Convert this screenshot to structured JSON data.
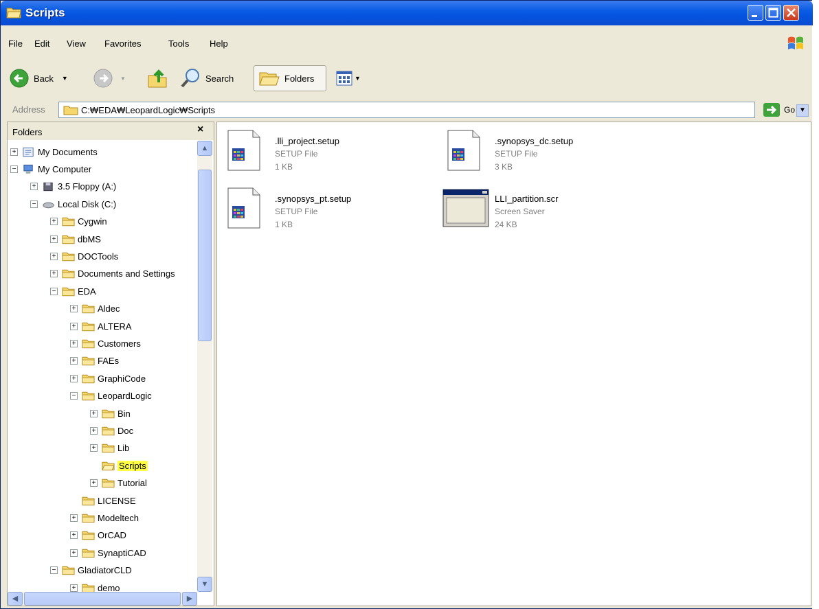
{
  "window": {
    "title": "Scripts"
  },
  "menubar": {
    "items": [
      "File",
      "Edit",
      "View",
      "Favorites",
      "Tools",
      "Help"
    ]
  },
  "toolbar": {
    "back": "Back",
    "search": "Search",
    "folders": "Folders"
  },
  "address": {
    "label": "Address",
    "path": "C:₩EDA₩LeopardLogic₩Scripts",
    "go": "Go"
  },
  "folders_pane": {
    "title": "Folders",
    "close": "×",
    "tree": [
      {
        "label": "My Documents",
        "level": 0,
        "expander": "+",
        "icon": "my-documents-icon"
      },
      {
        "label": "My Computer",
        "level": 0,
        "expander": "−",
        "icon": "my-computer-icon"
      },
      {
        "label": "3.5 Floppy (A:)",
        "level": 1,
        "expander": "+",
        "icon": "floppy-icon"
      },
      {
        "label": "Local Disk (C:)",
        "level": 1,
        "expander": "−",
        "icon": "disk-icon"
      },
      {
        "label": "Cygwin",
        "level": 2,
        "expander": "+",
        "icon": "folder-icon"
      },
      {
        "label": "dbMS",
        "level": 2,
        "expander": "+",
        "icon": "folder-icon"
      },
      {
        "label": "DOCTools",
        "level": 2,
        "expander": "+",
        "icon": "folder-icon"
      },
      {
        "label": "Documents and Settings",
        "level": 2,
        "expander": "+",
        "icon": "folder-icon"
      },
      {
        "label": "EDA",
        "level": 2,
        "expander": "−",
        "icon": "folder-icon"
      },
      {
        "label": "Aldec",
        "level": 3,
        "expander": "+",
        "icon": "folder-icon"
      },
      {
        "label": "ALTERA",
        "level": 3,
        "expander": "+",
        "icon": "folder-icon"
      },
      {
        "label": "Customers",
        "level": 3,
        "expander": "+",
        "icon": "folder-icon"
      },
      {
        "label": "FAEs",
        "level": 3,
        "expander": "+",
        "icon": "folder-icon"
      },
      {
        "label": "GraphiCode",
        "level": 3,
        "expander": "+",
        "icon": "folder-icon"
      },
      {
        "label": "LeopardLogic",
        "level": 3,
        "expander": "−",
        "icon": "folder-icon"
      },
      {
        "label": "Bin",
        "level": 4,
        "expander": "+",
        "icon": "folder-icon"
      },
      {
        "label": "Doc",
        "level": 4,
        "expander": "+",
        "icon": "folder-icon"
      },
      {
        "label": "Lib",
        "level": 4,
        "expander": "+",
        "icon": "folder-icon"
      },
      {
        "label": "Scripts",
        "level": 4,
        "expander": "",
        "icon": "folder-open-icon",
        "selected": true
      },
      {
        "label": "Tutorial",
        "level": 4,
        "expander": "+",
        "icon": "folder-icon"
      },
      {
        "label": "LICENSE",
        "level": 3,
        "expander": "",
        "icon": "folder-icon"
      },
      {
        "label": "Modeltech",
        "level": 3,
        "expander": "+",
        "icon": "folder-icon"
      },
      {
        "label": "OrCAD",
        "level": 3,
        "expander": "+",
        "icon": "folder-icon"
      },
      {
        "label": "SynaptiCAD",
        "level": 3,
        "expander": "+",
        "icon": "folder-icon"
      },
      {
        "label": "GladiatorCLD",
        "level": 2,
        "expander": "−",
        "icon": "folder-icon"
      },
      {
        "label": "demo",
        "level": 3,
        "expander": "+",
        "icon": "folder-icon"
      }
    ]
  },
  "files": [
    {
      "name": ".lli_project.setup",
      "type": "SETUP File",
      "size": "1 KB",
      "icon": "setup-file-icon"
    },
    {
      "name": ".synopsys_dc.setup",
      "type": "SETUP File",
      "size": "3 KB",
      "icon": "setup-file-icon"
    },
    {
      "name": ".synopsys_pt.setup",
      "type": "SETUP File",
      "size": "1 KB",
      "icon": "setup-file-icon"
    },
    {
      "name": "LLI_partition.scr",
      "type": "Screen Saver",
      "size": "24 KB",
      "icon": "screen-saver-icon"
    }
  ]
}
